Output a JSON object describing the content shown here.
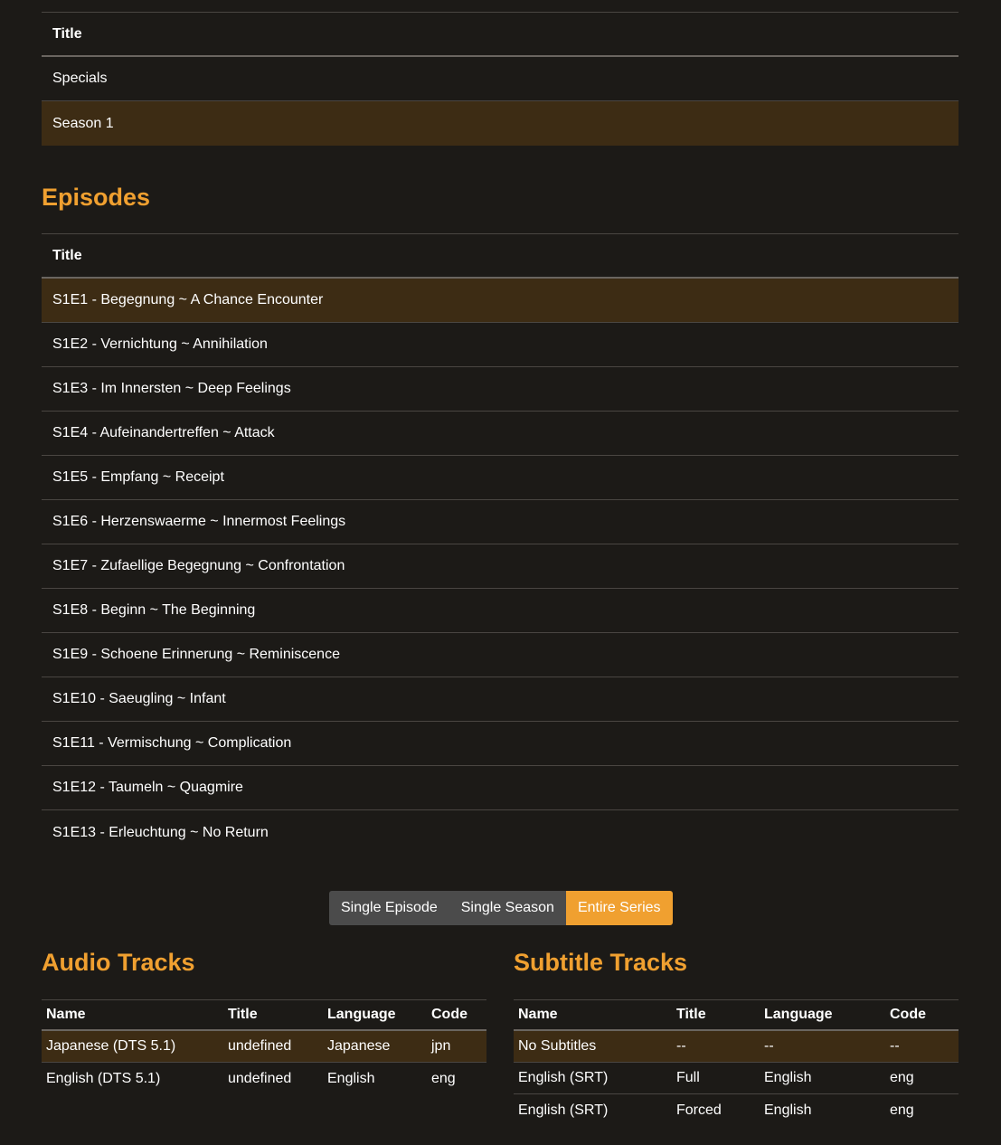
{
  "seasons": {
    "header": "Title",
    "rows": [
      "Specials",
      "Season 1"
    ],
    "selected_index": 1
  },
  "episodes": {
    "section_title": "Episodes",
    "header": "Title",
    "rows": [
      "S1E1 - Begegnung ~ A Chance Encounter",
      "S1E2 - Vernichtung ~ Annihilation",
      "S1E3 - Im Innersten ~ Deep Feelings",
      "S1E4 - Aufeinandertreffen ~ Attack",
      "S1E5 - Empfang ~ Receipt",
      "S1E6 - Herzenswaerme ~ Innermost Feelings",
      "S1E7 - Zufaellige Begegnung ~ Confrontation",
      "S1E8 - Beginn ~ The Beginning",
      "S1E9 - Schoene Erinnerung ~ Reminiscence",
      "S1E10 - Saeugling ~ Infant",
      "S1E11 - Vermischung ~ Complication",
      "S1E12 - Taumeln ~ Quagmire",
      "S1E13 - Erleuchtung ~ No Return"
    ],
    "selected_index": 0
  },
  "scope": {
    "options": [
      "Single Episode",
      "Single Season",
      "Entire Series"
    ],
    "active_index": 2
  },
  "audio": {
    "section_title": "Audio Tracks",
    "columns": [
      "Name",
      "Title",
      "Language",
      "Code"
    ],
    "rows": [
      [
        "Japanese (DTS 5.1)",
        "undefined",
        "Japanese",
        "jpn"
      ],
      [
        "English (DTS 5.1)",
        "undefined",
        "English",
        "eng"
      ]
    ],
    "selected_index": 0
  },
  "subtitles": {
    "section_title": "Subtitle Tracks",
    "columns": [
      "Name",
      "Title",
      "Language",
      "Code"
    ],
    "rows": [
      [
        "No Subtitles",
        "--",
        "--",
        "--"
      ],
      [
        "English (SRT)",
        "Full",
        "English",
        "eng"
      ],
      [
        "English (SRT)",
        "Forced",
        "English",
        "eng"
      ]
    ],
    "selected_index": 0
  },
  "colors": {
    "accent": "#f0a030",
    "selected_row": "#3d2c14",
    "background": "#1c1a17"
  }
}
